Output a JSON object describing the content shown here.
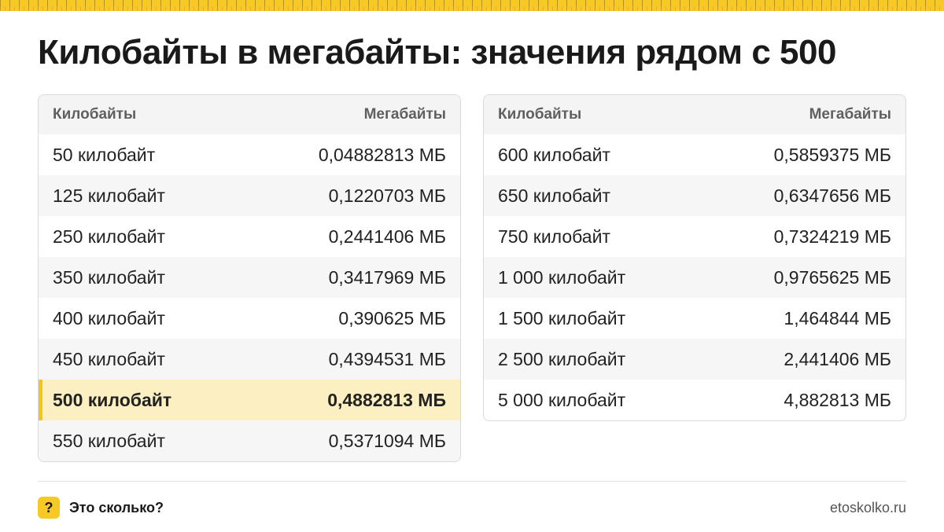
{
  "title": "Килобайты в мегабайты: значения рядом с 500",
  "headers": {
    "kb": "Килобайты",
    "mb": "Мегабайты"
  },
  "left_rows": [
    {
      "kb": "50 килобайт",
      "mb": "0,04882813 МБ"
    },
    {
      "kb": "125 килобайт",
      "mb": "0,1220703 МБ"
    },
    {
      "kb": "250 килобайт",
      "mb": "0,2441406 МБ"
    },
    {
      "kb": "350 килобайт",
      "mb": "0,3417969 МБ"
    },
    {
      "kb": "400 килобайт",
      "mb": "0,390625 МБ"
    },
    {
      "kb": "450 килобайт",
      "mb": "0,4394531 МБ"
    },
    {
      "kb": "500 килобайт",
      "mb": "0,4882813 МБ"
    },
    {
      "kb": "550 килобайт",
      "mb": "0,5371094 МБ"
    }
  ],
  "right_rows": [
    {
      "kb": "600 килобайт",
      "mb": "0,5859375 МБ"
    },
    {
      "kb": "650 килобайт",
      "mb": "0,6347656 МБ"
    },
    {
      "kb": "750 килобайт",
      "mb": "0,7324219 МБ"
    },
    {
      "kb": "1 000 килобайт",
      "mb": "0,9765625 МБ"
    },
    {
      "kb": "1 500 килобайт",
      "mb": "1,464844 МБ"
    },
    {
      "kb": "2 500 килобайт",
      "mb": "2,441406 МБ"
    },
    {
      "kb": "5 000 килобайт",
      "mb": "4,882813 МБ"
    }
  ],
  "highlight_color": "#f5c518",
  "footer": {
    "badge": "?",
    "brand": "Это сколько?",
    "site": "etoskolko.ru"
  }
}
